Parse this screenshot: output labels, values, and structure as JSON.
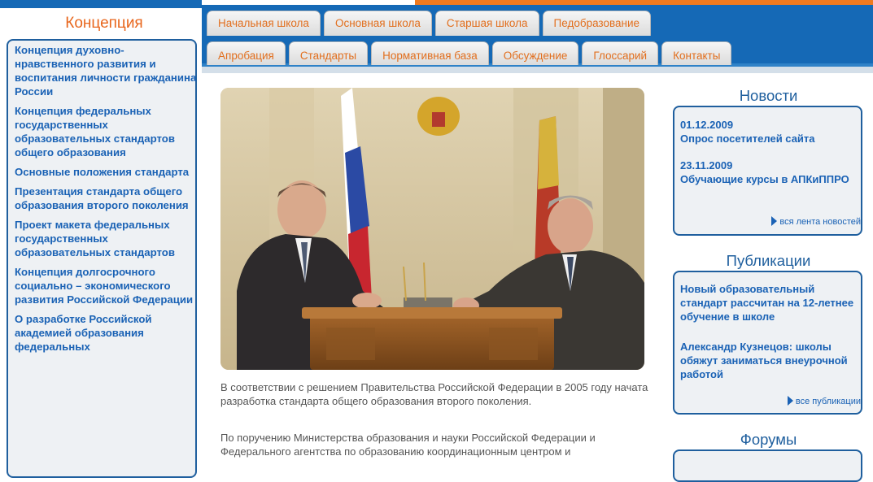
{
  "nav": {
    "row1": [
      "Начальная школа",
      "Основная школа",
      "Старшая школа",
      "Педобразование"
    ],
    "row2": [
      "Апробация",
      "Стандарты",
      "Нормативная база",
      "Обсуждение",
      "Глоссарий",
      "Контакты"
    ]
  },
  "sidebar": {
    "title": "Концепция",
    "items": [
      "Концепция духовно-нравственного развития и воспитания личности гражданина России",
      "Концепция федеральных государственных образовательных стандартов общего образования",
      "Основные положения стандарта",
      "Презентация стандарта общего образования второго поколения",
      "Проект макета федеральных государственных образовательных стандартов",
      "Концепция долгосрочного социально – экономического развития Российской Федерации",
      "О разработке Российской академией образования федеральных"
    ]
  },
  "main": {
    "paragraph1": "В соответствии с решением Правительства Российской Федерации в 2005 году начата разработка стандарта общего образования второго поколения.",
    "paragraph2": "По поручению Министерства образования и науки Российской Федерации и Федерального агентства по образованию координационным центром и"
  },
  "news": {
    "title": "Новости",
    "items": [
      {
        "date": "01.12.2009",
        "text": "Опрос посетителей сайта"
      },
      {
        "date": "23.11.2009",
        "text": "Обучающие курсы в АПКиППРО"
      }
    ],
    "more": "вся лента новостей"
  },
  "publications": {
    "title": "Публикации",
    "items": [
      "Новый образовательный стандарт рассчитан на 12-летнее обучение в школе",
      "Александр Кузнецов: школы обяжут заниматься внеурочной работой"
    ],
    "more": "все публикации"
  },
  "forums": {
    "title": "Форумы"
  },
  "colors": {
    "brand_blue": "#1569b6",
    "accent_orange": "#e8661c",
    "link_blue": "#1a62b5"
  }
}
